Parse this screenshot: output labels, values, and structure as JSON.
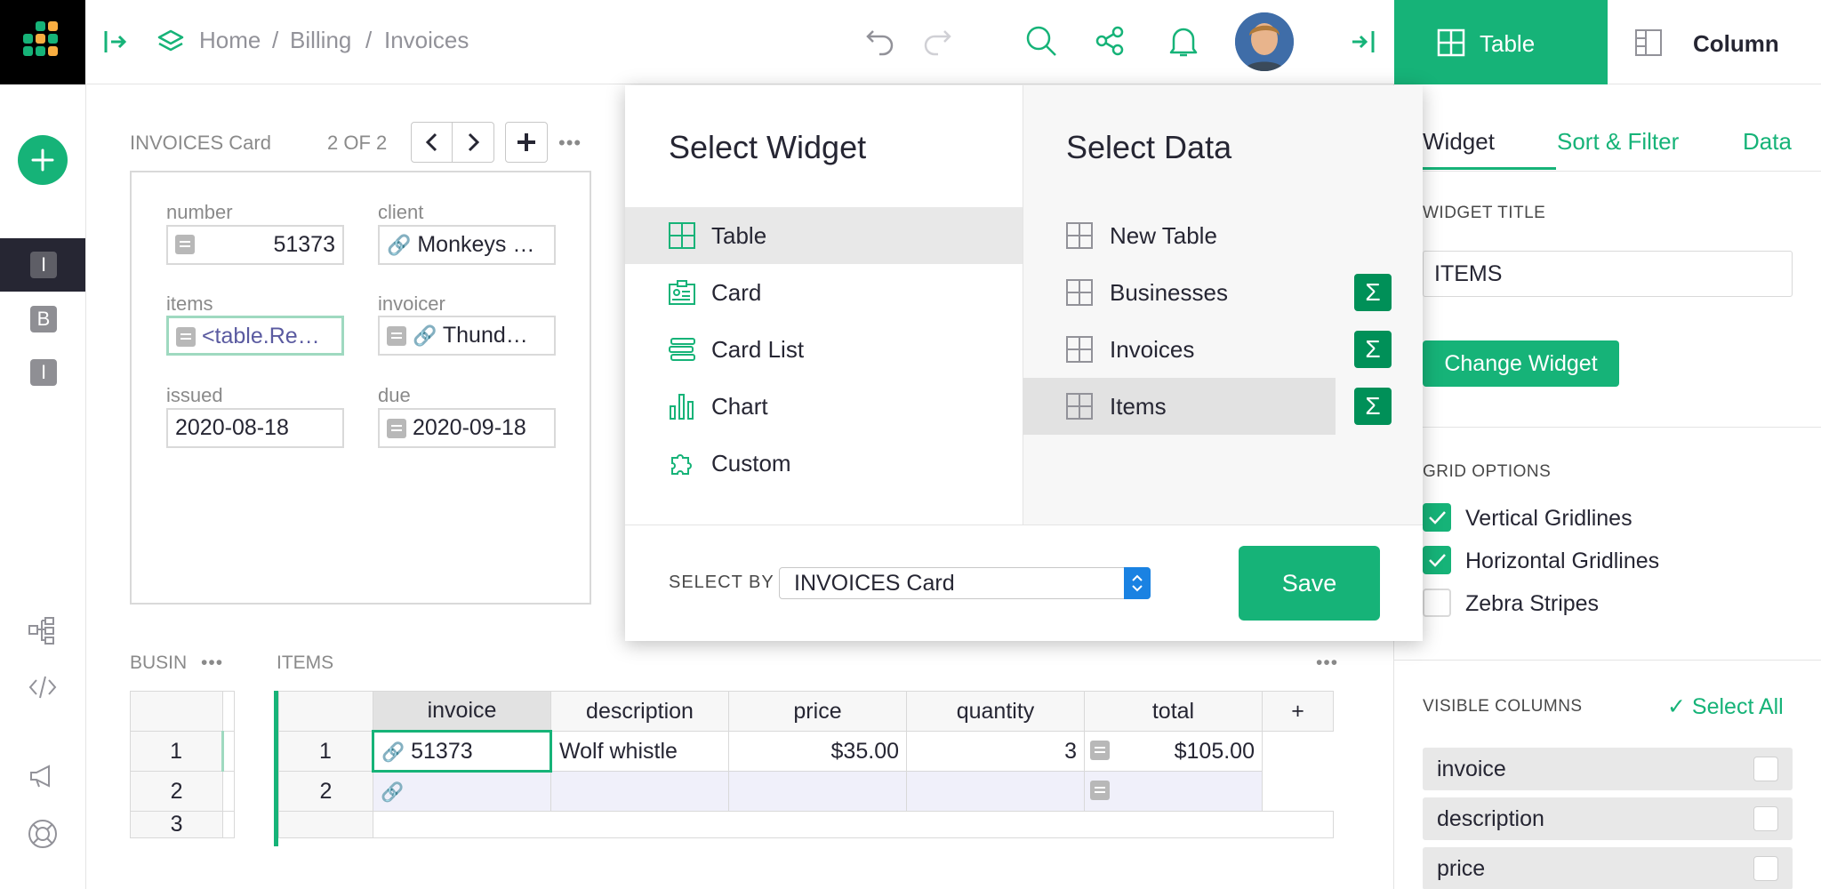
{
  "breadcrumb": {
    "home": "Home",
    "sep1": "/",
    "billing": "Billing",
    "sep2": "/",
    "invoices": "Invoices"
  },
  "left_rail": {
    "pages": [
      "I",
      "B",
      "I"
    ]
  },
  "header_tabs": {
    "table": "Table",
    "column": "Column"
  },
  "card_widget": {
    "title": "INVOICES Card",
    "pager": "2 OF 2",
    "fields": {
      "number": {
        "label": "number",
        "value": "51373"
      },
      "client": {
        "label": "client",
        "value": "Monkeys …"
      },
      "items": {
        "label": "items",
        "value": "<table.Re…"
      },
      "invoicer": {
        "label": "invoicer",
        "value": "Thund…"
      },
      "issued": {
        "label": "issued",
        "value": "2020-08-18"
      },
      "due": {
        "label": "due",
        "value": "2020-09-18"
      }
    }
  },
  "busin_widget": {
    "title": "BUSIN",
    "rows": [
      "1",
      "2",
      "3"
    ]
  },
  "items_widget": {
    "title": "ITEMS",
    "columns": [
      "invoice",
      "description",
      "price",
      "quantity",
      "total",
      "+"
    ],
    "rows": [
      {
        "num": "1",
        "invoice": "51373",
        "description": "Wolf whistle",
        "price": "$35.00",
        "quantity": "3",
        "total": "$105.00"
      },
      {
        "num": "2",
        "invoice": "",
        "description": "",
        "price": "",
        "quantity": "",
        "total": ""
      }
    ]
  },
  "popup": {
    "select_widget_title": "Select Widget",
    "select_data_title": "Select Data",
    "widgets": [
      {
        "label": "Table",
        "icon": "table-icon",
        "selected": true
      },
      {
        "label": "Card",
        "icon": "card-icon",
        "selected": false
      },
      {
        "label": "Card List",
        "icon": "card-list-icon",
        "selected": false
      },
      {
        "label": "Chart",
        "icon": "chart-icon",
        "selected": false
      },
      {
        "label": "Custom",
        "icon": "custom-widget-icon",
        "selected": false
      }
    ],
    "data": [
      {
        "label": "New Table",
        "sigma": false,
        "selected": false
      },
      {
        "label": "Businesses",
        "sigma": true,
        "selected": false
      },
      {
        "label": "Invoices",
        "sigma": true,
        "selected": false
      },
      {
        "label": "Items",
        "sigma": true,
        "selected": true
      }
    ],
    "sigma_symbol": "Σ",
    "select_by_label": "SELECT BY",
    "select_by_value": "INVOICES Card",
    "save_label": "Save"
  },
  "right_panel": {
    "subtabs": [
      "Widget",
      "Sort & Filter",
      "Data"
    ],
    "widget_title_label": "WIDGET TITLE",
    "widget_title_value": "ITEMS",
    "change_widget_label": "Change Widget",
    "grid_options_label": "GRID OPTIONS",
    "grid_options": [
      {
        "label": "Vertical Gridlines",
        "checked": true
      },
      {
        "label": "Horizontal Gridlines",
        "checked": true
      },
      {
        "label": "Zebra Stripes",
        "checked": false
      }
    ],
    "visible_columns_label": "VISIBLE COLUMNS",
    "select_all_label": "Select All",
    "visible_columns": [
      "invoice",
      "description",
      "price"
    ]
  },
  "colors": {
    "accent": "#16b378",
    "accent_dark": "#009058",
    "dark": "#262633"
  }
}
